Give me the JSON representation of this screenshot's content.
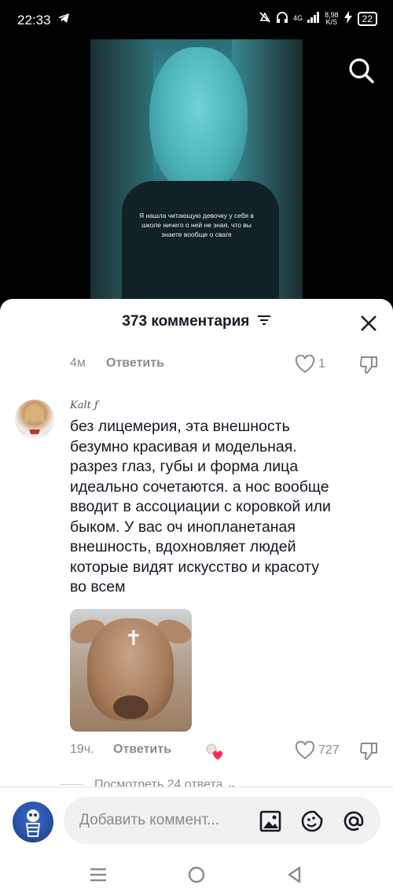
{
  "status_bar": {
    "time": "22:33",
    "network": "4G",
    "speed_value": "8,98",
    "speed_unit": "K/S",
    "battery": "22"
  },
  "video": {
    "caption": "Я нашла читающую девочку у себя в школе ничего о ней не зная, что вы знаете вообще о сваге"
  },
  "comments_sheet": {
    "title": "373 комментария",
    "previous_comment": {
      "time": "4м",
      "reply_label": "Ответить",
      "likes": "1"
    },
    "comment": {
      "username": "Kalt ƒ",
      "text": "без лицемерия, эта внешность безумно красивая и модельная. разрез глаз, губы и форма лица идеально сочетаются. а нос вообще вводит в ассоциации с коровкой или быком. У вас оч инопланетаная внешность, вдохновляет людей которые видят искусство и красоту во всем",
      "time": "19ч.",
      "reply_label": "Ответить",
      "likes": "727",
      "more_replies": "Посмотреть 24 ответа"
    }
  },
  "input_bar": {
    "placeholder": "Добавить коммент..."
  },
  "colors": {
    "accent_red": "#fe2c55",
    "text_primary": "#161823",
    "text_secondary": "#8a8b91"
  }
}
